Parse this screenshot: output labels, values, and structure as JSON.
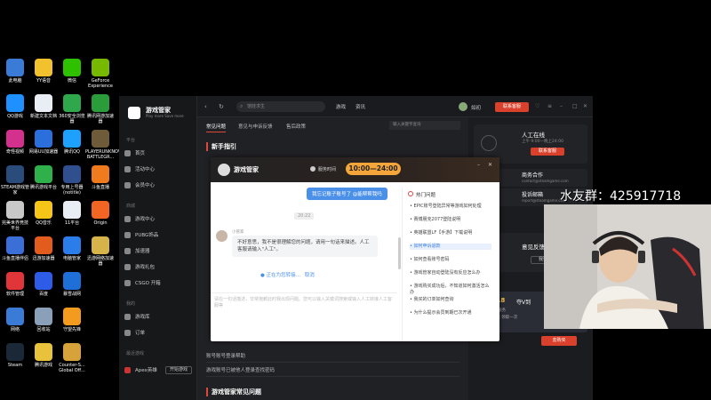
{
  "desktop_icons": [
    {
      "label": "此电脑",
      "color": "#3a7bd5",
      "col": 0,
      "row": 0
    },
    {
      "label": "YY语音",
      "color": "#f2c12e",
      "col": 1,
      "row": 0
    },
    {
      "label": "微信",
      "color": "#2dc100",
      "col": 2,
      "row": 0
    },
    {
      "label": "GeForce Experience",
      "color": "#76b900",
      "col": 3,
      "row": 0
    },
    {
      "label": "QQ游戏",
      "color": "#1e90ff",
      "col": 0,
      "row": 1
    },
    {
      "label": "新建文本文档",
      "color": "#e9eef5",
      "col": 1,
      "row": 1
    },
    {
      "label": "360安全浏览器",
      "color": "#2ea84a",
      "col": 2,
      "row": 1
    },
    {
      "label": "腾讯网游加速器",
      "color": "#2a9d3a",
      "col": 3,
      "row": 1
    },
    {
      "label": "奇怪视频",
      "color": "#d4318f",
      "col": 0,
      "row": 2
    },
    {
      "label": "网易UU加速器",
      "color": "#2a6fdb",
      "col": 1,
      "row": 2
    },
    {
      "label": "腾讯QQ",
      "color": "#1ea0ff",
      "col": 2,
      "row": 2
    },
    {
      "label": "PLAYERUNKNOWN'S BATTLEGR...",
      "color": "#6d5b3a",
      "col": 3,
      "row": 2
    },
    {
      "label": "STEAM游戏管家",
      "color": "#2a4c7a",
      "col": 0,
      "row": 3
    },
    {
      "label": "腾讯游戏平台",
      "color": "#2fb04a",
      "col": 1,
      "row": 3
    },
    {
      "label": "专用上号器(notitle)",
      "color": "#2f4f8f",
      "col": 2,
      "row": 3
    },
    {
      "label": "斗鱼直播",
      "color": "#f07b1e",
      "col": 3,
      "row": 3
    },
    {
      "label": "完美世界竞技平台",
      "color": "#c8c8c8",
      "col": 0,
      "row": 4
    },
    {
      "label": "QQ音乐",
      "color": "#f5c518",
      "col": 1,
      "row": 4
    },
    {
      "label": "11平台",
      "color": "#e9eef5",
      "col": 2,
      "row": 4
    },
    {
      "label": "Origin",
      "color": "#f26522",
      "col": 3,
      "row": 4
    },
    {
      "label": "斗鱼直播伴侣",
      "color": "#3a6fd8",
      "col": 0,
      "row": 5
    },
    {
      "label": "迅游加速器",
      "color": "#e25c1d",
      "col": 1,
      "row": 5
    },
    {
      "label": "电脑管家",
      "color": "#2b7de9",
      "col": 2,
      "row": 5
    },
    {
      "label": "迅游网络加速器",
      "color": "#d7b44a",
      "col": 3,
      "row": 5
    },
    {
      "label": "软件管理",
      "color": "#e0363a",
      "col": 0,
      "row": 6
    },
    {
      "label": "百度",
      "color": "#2d5ce8",
      "col": 1,
      "row": 6
    },
    {
      "label": "暴雪战网",
      "color": "#1f6fd9",
      "col": 2,
      "row": 6
    },
    {
      "label": "网络",
      "color": "#3a7bd5",
      "col": 0,
      "row": 7
    },
    {
      "label": "回收站",
      "color": "#8aa0b8",
      "col": 1,
      "row": 7
    },
    {
      "label": "守望先锋",
      "color": "#f29b1e",
      "col": 2,
      "row": 7
    },
    {
      "label": "Steam",
      "color": "#1b2838",
      "col": 0,
      "row": 8
    },
    {
      "label": "腾讯游戏",
      "color": "#e8c23a",
      "col": 1,
      "row": 8
    },
    {
      "label": "Counter-S... Global Off...",
      "color": "#d8a23a",
      "col": 2,
      "row": 8
    }
  ],
  "app": {
    "name": "游戏管家",
    "slogan": "Play more Save more",
    "search_placeholder": "馆娃求生",
    "top_tabs": [
      "游戏",
      "资讯"
    ],
    "user_name": "如初",
    "vip_label": "联系客服",
    "nav": {
      "section1": "平台",
      "items1": [
        "首页",
        "活动中心",
        "会员中心"
      ],
      "section2": "商城",
      "items2": [
        "游戏中心",
        "PUBG饰品",
        "加速器",
        "游戏礼包",
        "CSGO 开箱"
      ],
      "section3": "我的",
      "items3": [
        "游戏库",
        "订单"
      ],
      "section4": "最近游戏",
      "recent_game": "Apex英雄",
      "start_btn": "开始游戏"
    },
    "sub_tabs": [
      "常见问题",
      "意见与申诉反馈",
      "售后政策"
    ],
    "help_search_placeholder": "输入关键字查询",
    "section_title": "新手指引",
    "rows_bottom": [
      "账号账号登录帮助",
      "游戏账号已被他人登录查找密码"
    ],
    "section_title2": "游戏管家常见问题",
    "right_cards": [
      {
        "title": "人工在线",
        "sub": "上午 9:00—晚上24:00",
        "btn": "联系客服"
      },
      {
        "title": "商务合作",
        "sub": "contact@steamgame.com",
        "btn": ""
      },
      {
        "title": "投诉邮箱",
        "sub": "report@steamgame.com",
        "btn": ""
      },
      {
        "title": "意见反馈",
        "sub": "",
        "btn": "我要反馈"
      }
    ],
    "right_bottom_btn": "去购买"
  },
  "chat": {
    "title": "游戏管家",
    "service_time_label": "服务时间",
    "service_time": "10:00—24:00",
    "user_msg": "我忘记账子账号了 @能帮帮我吗",
    "time_tag": "20:22",
    "agent_name": "小管家",
    "bot_msg": "不好意思，我不是很理解您的问题，请用一句话来描述。人工客服请输入\"人工\"。",
    "transfer_text": "正在为您转接…",
    "cancel_text": "取消",
    "input_hint": "请在一句话描述，非常抱歉此时我出现问题。您可以输入关键词搜索或输入人工转接人工客服等",
    "hot_title": "热门问题",
    "hot_items": [
      "EPIC账号登陆异常等游戏如何处理",
      "赛博朋克2077登陆说明",
      "英雄联盟LF【手游】下载说明",
      "如何申诉退款",
      "如何查看账号密码",
      "游戏管家自动登陆没有反应怎么办",
      "游戏购买成功后，不知道如何激活怎么办",
      "我买的订单如何查询",
      "为什么提示会员到期已次开通"
    ],
    "active_hot_index": 3
  },
  "stream_overlay": {
    "qq_group": "水友群：425917718"
  },
  "right_panel_promo": {
    "discount": "¥8.8",
    "promo_title": "夺V到",
    "promo_sub": "小狗服务",
    "promo_time": "4-3天 领取一次"
  }
}
